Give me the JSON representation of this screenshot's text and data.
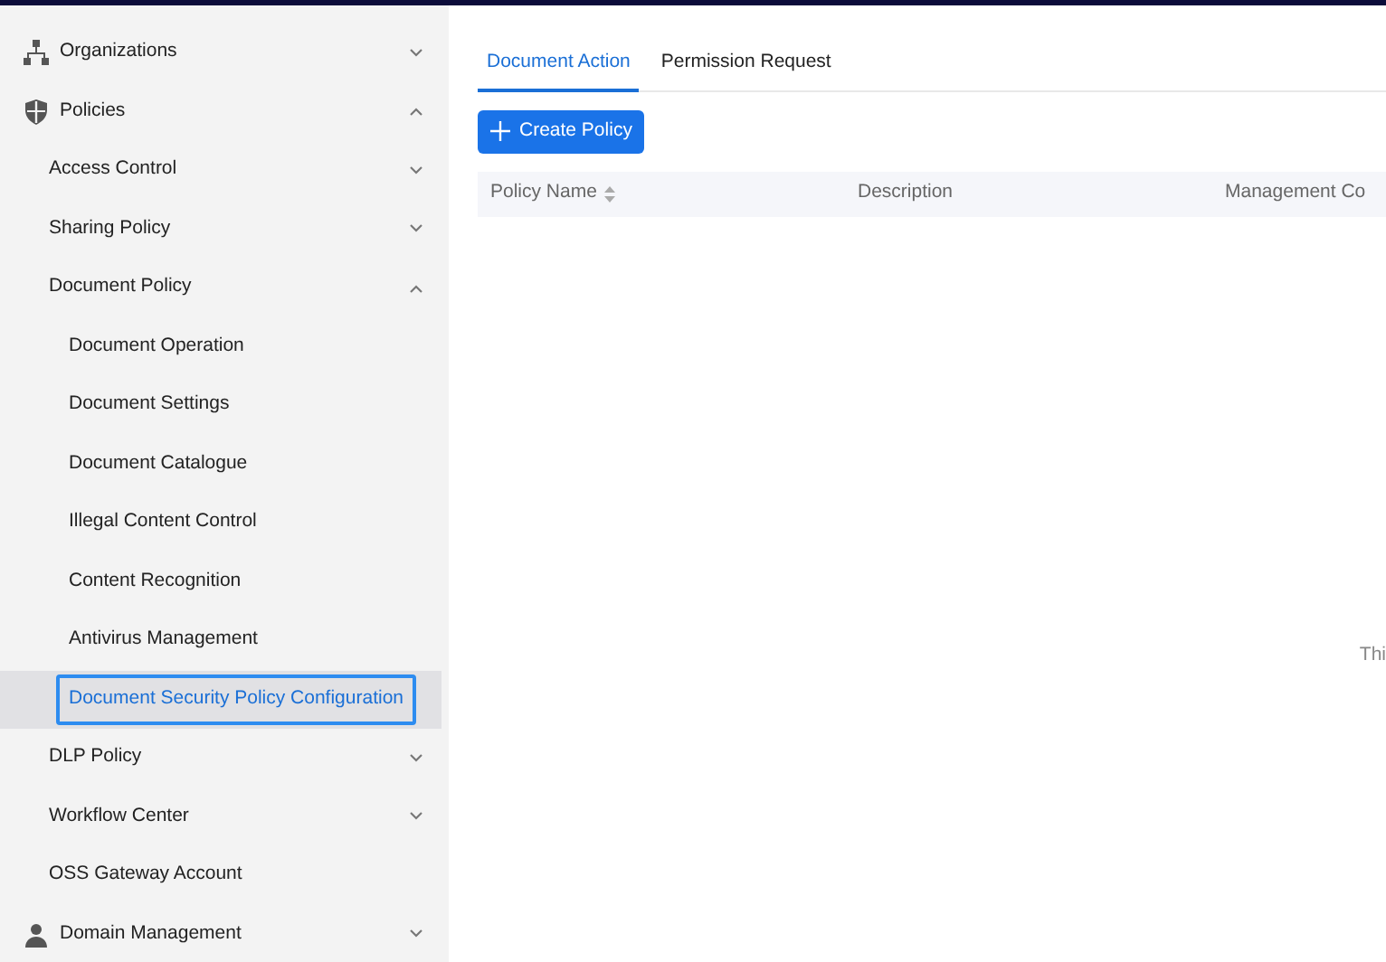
{
  "sidebar": {
    "items": [
      {
        "label": "Organizations",
        "kind": "org",
        "expanded": false,
        "selected": false
      },
      {
        "label": "Policies",
        "kind": "shield",
        "expanded": true,
        "selected": false,
        "children": [
          {
            "label": "Access Control",
            "expanded": false,
            "selected": false
          },
          {
            "label": "Sharing Policy",
            "expanded": false,
            "selected": false
          },
          {
            "label": "Document Policy",
            "expanded": true,
            "selected": false,
            "children": [
              {
                "label": "Document Operation",
                "selected": false
              },
              {
                "label": "Document Settings",
                "selected": false
              },
              {
                "label": "Document Catalogue",
                "selected": false
              },
              {
                "label": "Illegal Content Control",
                "selected": false
              },
              {
                "label": "Content Recognition",
                "selected": false
              },
              {
                "label": "Antivirus Management",
                "selected": false
              },
              {
                "label": "Document Security Policy Configuration",
                "selected": true
              }
            ]
          },
          {
            "label": "DLP Policy",
            "expanded": false,
            "selected": false
          },
          {
            "label": "Workflow Center",
            "expanded": false,
            "selected": false
          },
          {
            "label": "OSS Gateway Account",
            "selected": false
          }
        ]
      },
      {
        "label": "Domain Management",
        "kind": "person",
        "expanded": false,
        "selected": false
      }
    ]
  },
  "tabs": [
    {
      "label": "Document Action",
      "selected": true
    },
    {
      "label": "Permission Request",
      "selected": false
    }
  ],
  "create_button": "Create Policy",
  "table": {
    "columns": [
      {
        "label": "Policy Name",
        "sortable": true
      },
      {
        "label": "Description"
      },
      {
        "label": "Management Co"
      }
    ],
    "empty_text": "Thi"
  }
}
